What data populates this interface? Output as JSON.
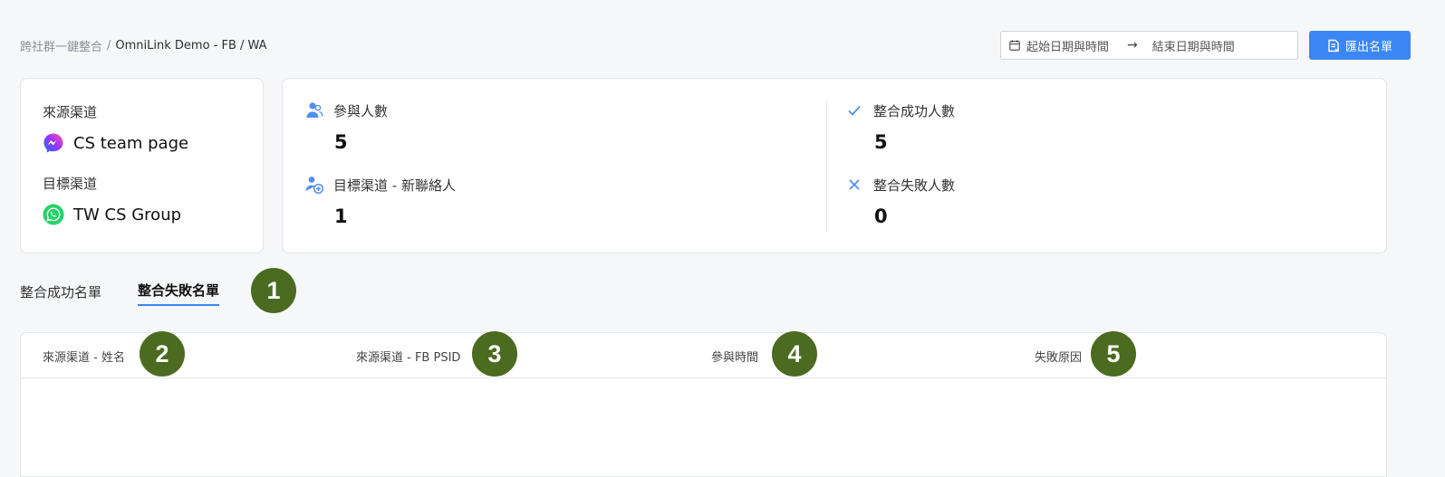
{
  "breadcrumb": {
    "parent": "跨社群一鍵整合",
    "separator": "/",
    "current": "OmniLink Demo - FB / WA"
  },
  "date_range": {
    "start_placeholder": "起始日期與時間",
    "arrow": "→",
    "end_placeholder": "結束日期與時間"
  },
  "export_button": {
    "label": "匯出名單"
  },
  "channels": {
    "source_label": "來源渠道",
    "source_name": "CS team page",
    "source_icon": "messenger-icon",
    "target_label": "目標渠道",
    "target_name": "TW CS Group",
    "target_icon": "whatsapp-icon"
  },
  "stats": {
    "participants": {
      "label": "參與人數",
      "value": "5",
      "icon": "users-icon"
    },
    "new_contacts": {
      "label": "目標渠道 - 新聯絡人",
      "value": "1",
      "icon": "user-add-icon"
    },
    "success": {
      "label": "整合成功人數",
      "value": "5",
      "icon": "check-icon"
    },
    "failed": {
      "label": "整合失敗人數",
      "value": "0",
      "icon": "x-icon"
    }
  },
  "tabs": [
    {
      "label": "整合成功名單",
      "active": false
    },
    {
      "label": "整合失敗名單",
      "active": true
    }
  ],
  "table": {
    "columns": [
      "來源渠道 - 姓名",
      "來源渠道 - FB PSID",
      "參與時間",
      "失敗原因"
    ],
    "rows": []
  },
  "annotations": [
    "1",
    "2",
    "3",
    "4",
    "5"
  ],
  "colors": {
    "accent": "#3b86f5",
    "badge": "#4a6b20",
    "background": "#f6f7f9"
  }
}
